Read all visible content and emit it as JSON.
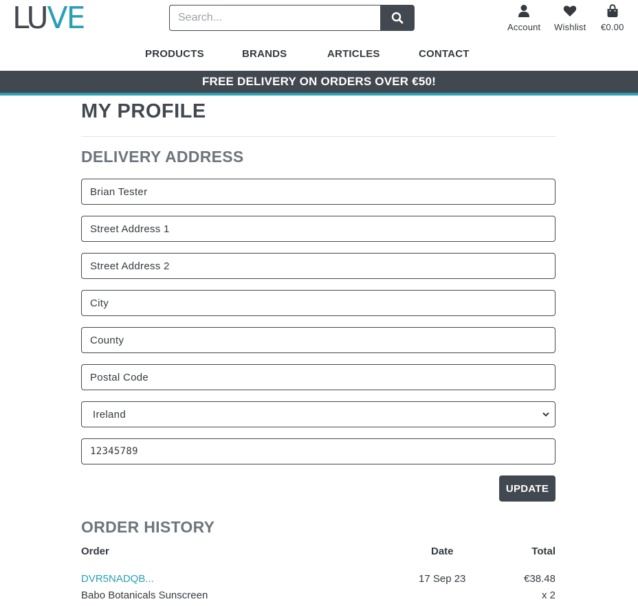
{
  "brand": {
    "logo_part1": "LU",
    "logo_part2": "VE",
    "accent": "#2aa0b4",
    "dark": "#424850"
  },
  "search": {
    "placeholder": "Search...",
    "button_icon": "search-icon"
  },
  "header_icons": [
    {
      "icon": "user-icon",
      "label": "Account"
    },
    {
      "icon": "heart-icon",
      "label": "Wishlist"
    },
    {
      "icon": "shopping-bag-icon",
      "label": "€0.00"
    }
  ],
  "nav": {
    "items": [
      "PRODUCTS",
      "BRANDS",
      "ARTICLES",
      "CONTACT"
    ]
  },
  "banner": {
    "text": "FREE DELIVERY ON ORDERS OVER €50!"
  },
  "profile": {
    "title": "MY PROFILE",
    "delivery_title": "DELIVERY ADDRESS",
    "fields": {
      "full_name": "Brian Tester",
      "street1_placeholder": "Street Address 1",
      "street2_placeholder": "Street Address 2",
      "city_placeholder": "City",
      "county_placeholder": "County",
      "postcode_placeholder": "Postal Code",
      "country": "Ireland",
      "phone": "12345789"
    },
    "update_label": "UPDATE"
  },
  "orders": {
    "title": "ORDER HISTORY",
    "columns": [
      "Order",
      "Date",
      "Total"
    ],
    "rows": [
      {
        "order": "DVR5NADQB...",
        "date": "17 Sep 23",
        "total": "€38.48",
        "item": "Babo Botanicals Sunscreen",
        "qty": "x 2"
      }
    ]
  }
}
